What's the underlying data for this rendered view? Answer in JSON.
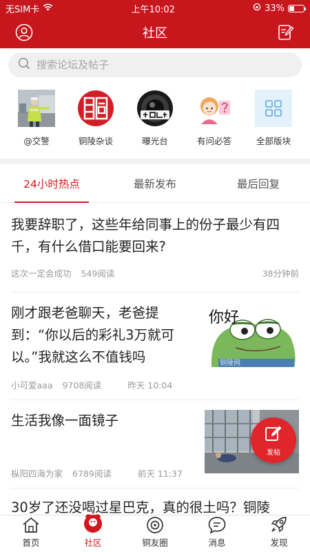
{
  "status_bar": {
    "carrier": "无SIM卡",
    "time": "上午10:02",
    "battery": "33%",
    "battery_level": 0.33
  },
  "header": {
    "title": "社区",
    "left_icon": "user-icon",
    "right_icon": "edit-icon"
  },
  "search": {
    "placeholder": "搜索论坛及帖子"
  },
  "boards": [
    {
      "label": "@交警",
      "icon": "traffic-police-photo"
    },
    {
      "label": "铜陵杂谈",
      "icon": "tongling-seal-logo"
    },
    {
      "label": "曝光台",
      "icon": "camera-lens-logo"
    },
    {
      "label": "有问必答",
      "icon": "cartoon-girl-logo"
    },
    {
      "label": "全部版块",
      "icon": "grid-icon"
    }
  ],
  "tabs": [
    {
      "label": "24小时热点",
      "active": true
    },
    {
      "label": "最新发布",
      "active": false
    },
    {
      "label": "最后回复",
      "active": false
    }
  ],
  "posts": [
    {
      "title": "我要辞职了，这些年给同事上的份子最少有四千，有什么借口能要回来?",
      "author": "这次一定会成功",
      "reads": "549阅读",
      "time": "38分钟前"
    },
    {
      "title": "刚才跟老爸聊天，老爸提到：“你以后的彩礼3万就可以。”我就这么不值钱吗",
      "author": "小可爱aaa",
      "reads": "9708阅读",
      "time": "昨天 10:04",
      "image_text": "你好",
      "image_watermark": "铜陵网"
    },
    {
      "title": "生活我像一面镜子",
      "author": "枞阳四海为家",
      "reads": "6789阅读",
      "time": "前天 11:37"
    },
    {
      "title": "30岁了还没喝过星巴克，真的很土吗？铜陵"
    }
  ],
  "fab": {
    "label": "发帖"
  },
  "tabbar": [
    {
      "label": "首页",
      "icon": "home-icon",
      "active": false
    },
    {
      "label": "社区",
      "icon": "community-icon",
      "active": true
    },
    {
      "label": "铜友圈",
      "icon": "circle-icon",
      "active": false
    },
    {
      "label": "消息",
      "icon": "message-icon",
      "active": false
    },
    {
      "label": "发现",
      "icon": "rocket-icon",
      "active": false
    }
  ],
  "colors": {
    "brand_red": "#c8161d",
    "active_red": "#d4171f",
    "fab_red": "#e0252b"
  }
}
